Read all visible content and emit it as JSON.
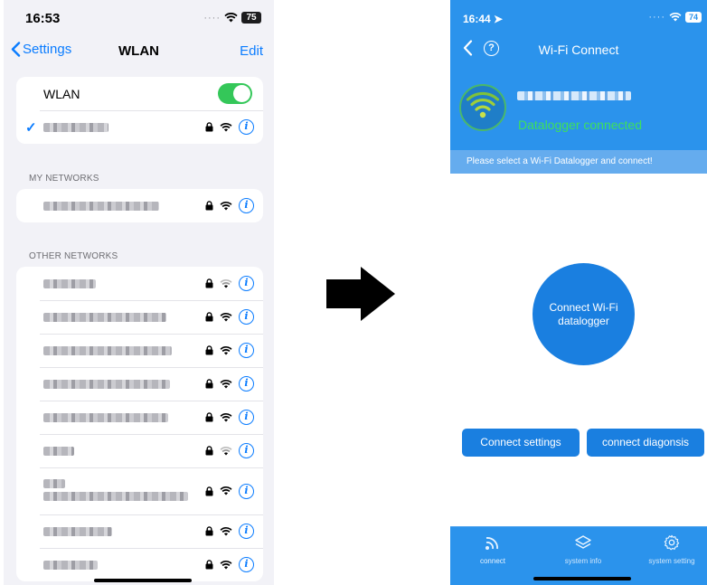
{
  "left": {
    "status": {
      "time": "16:53",
      "battery": "75"
    },
    "nav": {
      "back_label": "Settings",
      "title": "WLAN",
      "edit_label": "Edit"
    },
    "wlan_toggle": {
      "label": "WLAN",
      "on": true
    },
    "sections": {
      "my_networks": "MY NETWORKS",
      "other_networks": "OTHER NETWORKS"
    }
  },
  "right": {
    "status": {
      "time": "16:44",
      "battery": "74"
    },
    "nav": {
      "title": "Wi-Fi Connect"
    },
    "connection_status": "Datalogger connected",
    "prompt": "Please select a Wi-Fi Datalogger and connect!",
    "main_button": "Connect Wi-Fi datalogger",
    "buttons": {
      "connect_settings": "Connect settings",
      "connect_diagnosis": "connect diagonsis"
    },
    "tabs": [
      {
        "label": "connect",
        "icon": "wifi-signal-icon"
      },
      {
        "label": "system info",
        "icon": "layers-icon"
      },
      {
        "label": "system setting",
        "icon": "gear-icon"
      }
    ]
  },
  "colors": {
    "ios_blue": "#0a7cff",
    "toggle_green": "#34c759",
    "app_blue": "#2b93ec",
    "button_blue": "#1a7fe0",
    "connected_green": "#3ee05b"
  }
}
